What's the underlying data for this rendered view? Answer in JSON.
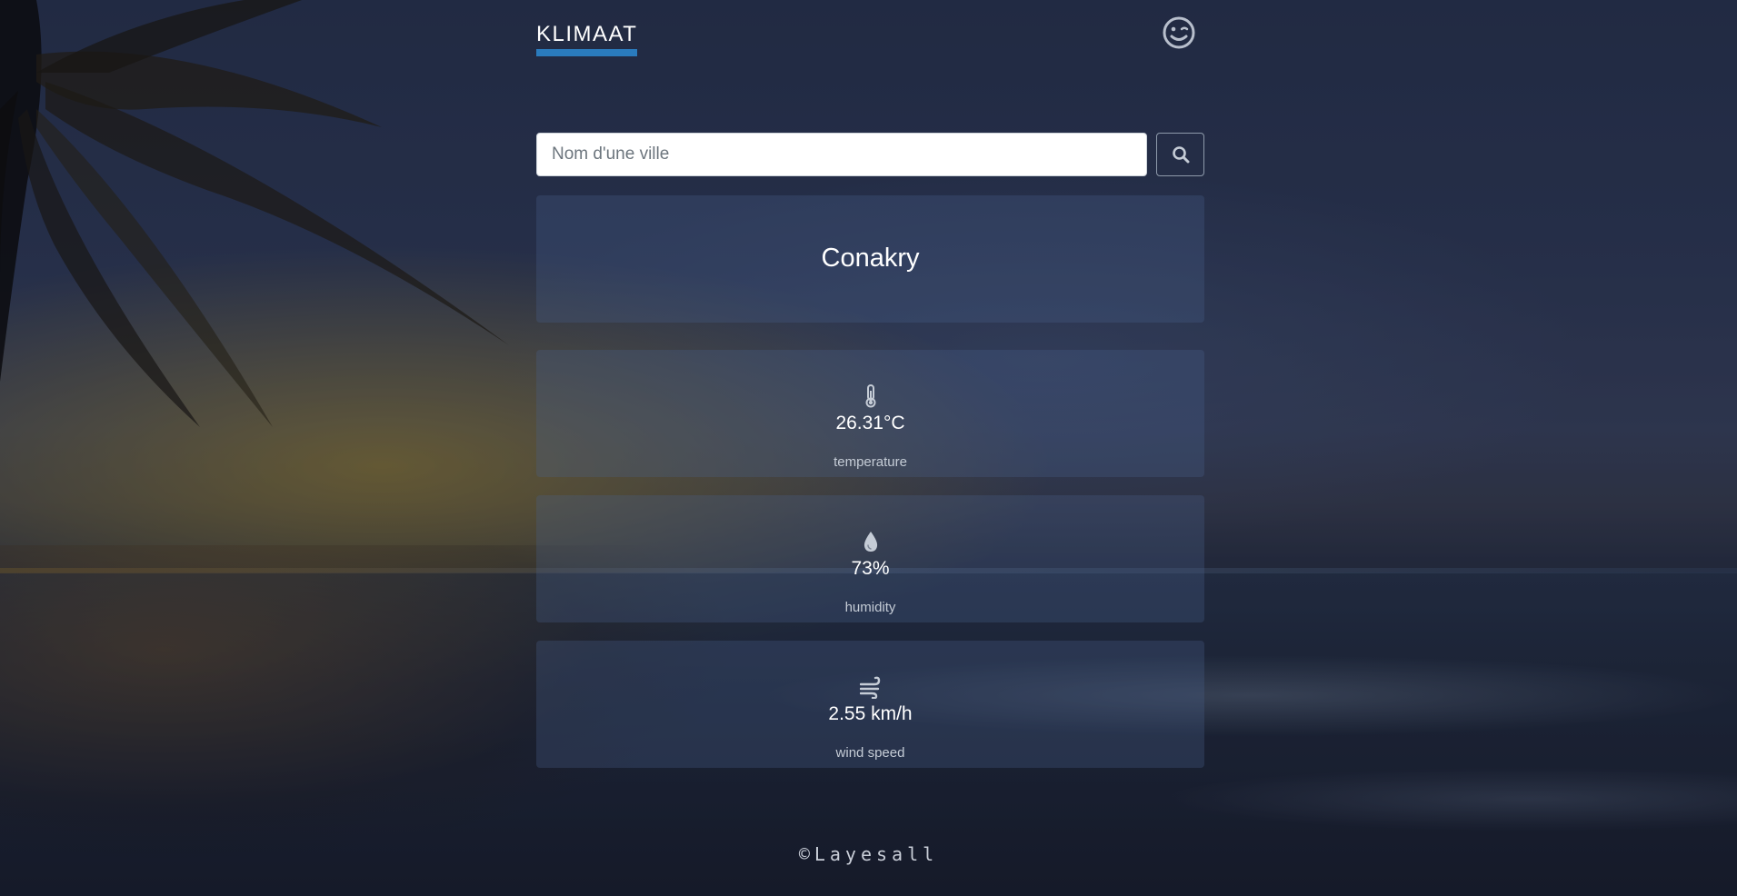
{
  "header": {
    "brand": "KLIMAAT",
    "brand_underline_color": "#2a7bbd",
    "right_icon": "smile-wink-icon"
  },
  "search": {
    "placeholder": "Nom d'une ville",
    "value": "",
    "button_icon": "search-icon"
  },
  "weather": {
    "city": "Conakry",
    "stats": [
      {
        "icon": "thermometer-icon",
        "value": "26.31°C",
        "label": "temperature"
      },
      {
        "icon": "water-drop-icon",
        "value": "73%",
        "label": "humidity"
      },
      {
        "icon": "wind-icon",
        "value": "2.55 km/h",
        "label": "wind speed"
      }
    ]
  },
  "footer": {
    "text": "©Layesall"
  },
  "colors": {
    "card_background": "rgba(74,96,140,0.30)",
    "text": "#ffffff",
    "label": "#c5ccd6"
  }
}
